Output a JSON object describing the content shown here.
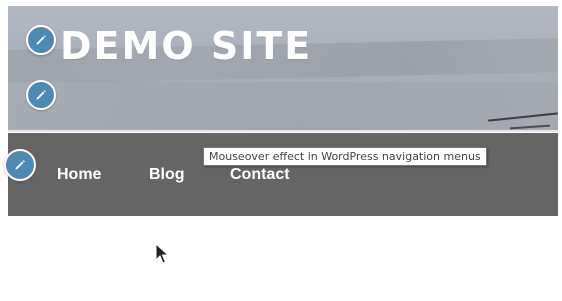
{
  "site": {
    "title": "DEMO SITE"
  },
  "nav": {
    "items": [
      {
        "label": "Home"
      },
      {
        "label": "Blog"
      },
      {
        "label": "Contact"
      }
    ]
  },
  "tooltip": {
    "text": "Mouseover effect in WordPress navigation menus"
  },
  "icons": {
    "edit": "pencil-icon",
    "cursor": "mouse-pointer"
  },
  "colors": {
    "header_bg": "#a9afb9",
    "nav_bg": "#656565",
    "edit_button": "#4d8ab3",
    "text_light": "#ffffff"
  }
}
